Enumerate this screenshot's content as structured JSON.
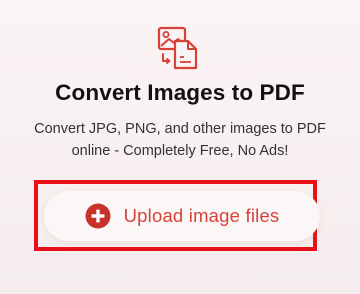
{
  "hero": {
    "icon": "images-to-pdf-icon",
    "title": "Convert Images to PDF",
    "subtitle_line1": "Convert JPG, PNG, and other images to PDF",
    "subtitle_line2": "online - Completely Free, No Ads!"
  },
  "upload": {
    "label": "Upload image files",
    "icon": "plus-circle-icon"
  },
  "colors": {
    "accent": "#d8413a",
    "highlight": "#e8111a",
    "background": "#f8f1f1"
  }
}
